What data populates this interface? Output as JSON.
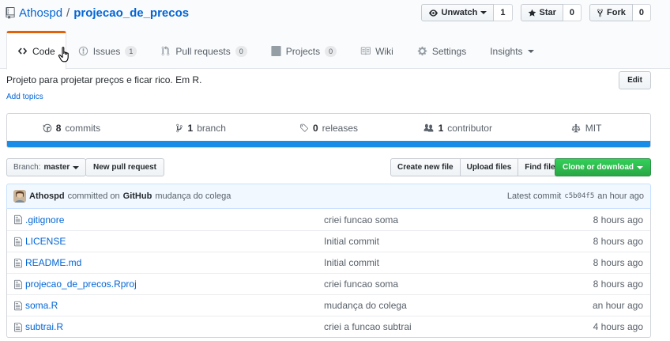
{
  "repo": {
    "owner": "Athospd",
    "separator": "/",
    "name": "projecao_de_precos"
  },
  "actions": {
    "watch_label": "Unwatch",
    "watch_count": "1",
    "star_label": "Star",
    "star_count": "0",
    "fork_label": "Fork",
    "fork_count": "0"
  },
  "tabs": [
    {
      "label": "Code",
      "icon": "code-icon",
      "selected": true
    },
    {
      "label": "Issues",
      "counter": "1",
      "icon": "issue-icon"
    },
    {
      "label": "Pull requests",
      "counter": "0",
      "icon": "pull-request-icon"
    },
    {
      "label": "Projects",
      "counter": "0",
      "icon": "project-icon"
    },
    {
      "label": "Wiki",
      "icon": "book-icon"
    },
    {
      "label": "Settings",
      "icon": "gear-icon"
    },
    {
      "label": "Insights",
      "icon": "chevron-down-icon"
    }
  ],
  "about": {
    "description": "Projeto para projetar preços e ficar rico. Em R.",
    "add_topics": "Add topics",
    "edit_label": "Edit"
  },
  "summary": {
    "commits_count": "8",
    "commits_label": "commits",
    "branches_count": "1",
    "branches_label": "branch",
    "releases_count": "0",
    "releases_label": "releases",
    "contributors_count": "1",
    "contributors_label": "contributor",
    "license": "MIT",
    "language_color": "#198ce7"
  },
  "filenav": {
    "branch_prefix": "Branch:",
    "branch_name": "master",
    "new_pr": "New pull request",
    "create_file": "Create new file",
    "upload_files": "Upload files",
    "find_file": "Find file",
    "clone": "Clone or download"
  },
  "latest_commit": {
    "author": "Athospd",
    "committed_on": "committed on",
    "platform": "GitHub",
    "message": "mudança do colega",
    "prefix": "Latest commit",
    "sha": "c5b04f5",
    "age": "an hour ago"
  },
  "files": [
    {
      "name": ".gitignore",
      "message": "criei funcao soma",
      "age": "8 hours ago"
    },
    {
      "name": "LICENSE",
      "message": "Initial commit",
      "age": "8 hours ago"
    },
    {
      "name": "README.md",
      "message": "Initial commit",
      "age": "8 hours ago"
    },
    {
      "name": "projecao_de_precos.Rproj",
      "message": "criei funcao soma",
      "age": "8 hours ago"
    },
    {
      "name": "soma.R",
      "message": "mudança do colega",
      "age": "an hour ago"
    },
    {
      "name": "subtrai.R",
      "message": "criei a funcao subtrai",
      "age": "4 hours ago"
    }
  ]
}
